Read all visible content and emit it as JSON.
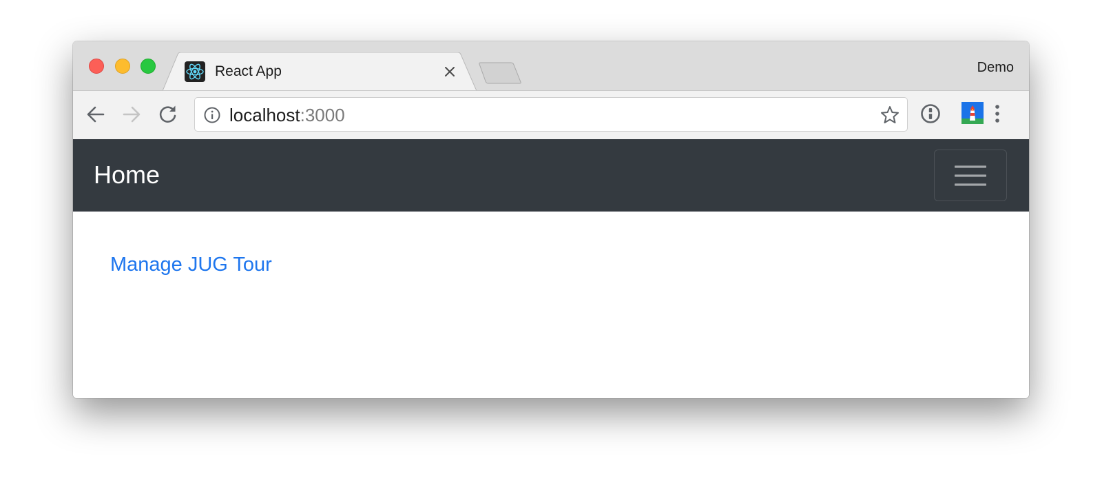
{
  "window": {
    "profile_name": "Demo"
  },
  "tabs": [
    {
      "title": "React App",
      "favicon": "react-icon",
      "active": true
    }
  ],
  "toolbar": {
    "back_icon": "arrow-left-icon",
    "forward_icon": "arrow-right-icon",
    "reload_icon": "reload-icon",
    "address": {
      "host": "localhost",
      "port": ":3000",
      "security_icon": "info-icon",
      "bookmark_icon": "star-icon"
    },
    "extensions": [
      "1password-icon",
      "lighthouse-icon"
    ],
    "menu_icon": "kebab-menu-icon"
  },
  "page": {
    "navbar": {
      "brand": "Home",
      "toggler_icon": "hamburger-icon"
    },
    "links": [
      {
        "label": "Manage JUG Tour"
      }
    ]
  },
  "colors": {
    "navbar_bg": "#343a40",
    "link": "#1e76ee",
    "traffic_red": "#fc5f57",
    "traffic_yellow": "#fdbc2e",
    "traffic_green": "#28c840"
  }
}
